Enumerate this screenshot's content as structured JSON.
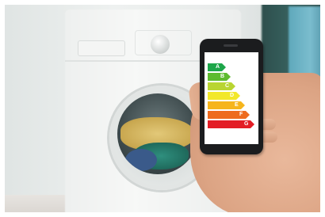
{
  "energy_label": {
    "classes": [
      {
        "letter": "A",
        "color": "#1ea64a"
      },
      {
        "letter": "B",
        "color": "#5dbb2f"
      },
      {
        "letter": "C",
        "color": "#b9d532"
      },
      {
        "letter": "D",
        "color": "#f2e82a"
      },
      {
        "letter": "E",
        "color": "#f6b51c"
      },
      {
        "letter": "F",
        "color": "#ee6b1e"
      },
      {
        "letter": "G",
        "color": "#e31d25"
      }
    ]
  }
}
